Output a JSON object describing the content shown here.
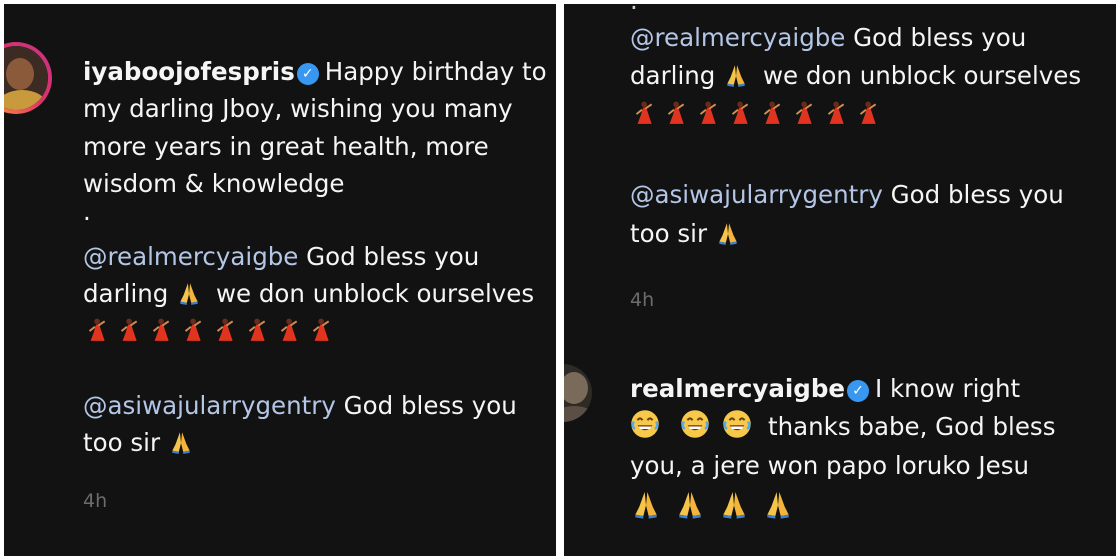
{
  "left": {
    "username": "iyaboojofespris",
    "caption_lines": [
      "Happy birthday to",
      "my darling Jboy, wishing you many",
      "more years in great health, more",
      "wisdom & knowledge"
    ],
    "dot": ".",
    "mention1": "@realmercyaigbe",
    "mention1_text_a": "God bless you",
    "mention1_text_b": "darling",
    "mention1_text_c": "we don unblock ourselves",
    "mention2": "@asiwajularrygentry",
    "mention2_text_a": "God bless you",
    "mention2_text_b": "too sir",
    "timestamp": "4h",
    "dancer_count": 8
  },
  "right": {
    "mention1": "@realmercyaigbe",
    "mention1_text_a": "God bless you",
    "mention1_text_b": "darling",
    "mention1_text_c": "we don unblock ourselves",
    "mention2": "@asiwajularrygentry",
    "mention2_text_a": "God bless you",
    "mention2_text_b": "too sir",
    "timestamp": "4h",
    "reply_username": "realmercyaigbe",
    "reply_line1": "I know right",
    "reply_line2": "thanks babe, God bless",
    "reply_line3": "you, a jere won papo loruko Jesu",
    "dancer_count": 8
  },
  "colors": {
    "background": "#121212",
    "mention": "#b4c6e6",
    "verified": "#3897f0",
    "timestamp": "#6c6c6c"
  },
  "icons": [
    "verified-badge-icon",
    "praying-hands-icon",
    "dancer-icon",
    "laughing-face-icon",
    "avatar"
  ]
}
